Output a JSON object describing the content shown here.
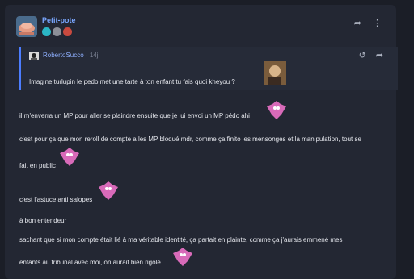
{
  "post": {
    "author": "Petit-pote",
    "badges": [
      {
        "icon": "teal-gem-badge-icon",
        "color": "#2bb6c5"
      },
      {
        "icon": "gray-shield-badge-icon",
        "color": "#8c8f98"
      },
      {
        "icon": "red-star-badge-icon",
        "color": "#c94a3f"
      }
    ],
    "header_icons": [
      "share-icon",
      "more-vertical-icon"
    ],
    "quote": {
      "author": "RobertoSucco",
      "separator": "·",
      "time": "14j",
      "text": "Imagine turlupin le pedo met une tarte à ton enfant tu fais quoi kheyou ?",
      "icons": [
        "history-icon",
        "share-icon"
      ]
    },
    "lines": [
      "il m'enverra un MP pour aller se plaindre ensuite que je lui envoi un MP pédo ahi",
      "c'est pour ça que mon reroll de compte a les MP bloqué mdr, comme ça finito les mensonges et la manipulation, tout se",
      "fait en public",
      "c'est l'astuce anti salopes",
      "à bon entendeur",
      "sachant que si mon compte était lié à ma véritable identité, ça partait en plainte, comme ça j'aurais emmené mes",
      "enfants au tribunal avec moi, on aurait bien rigolé"
    ]
  }
}
